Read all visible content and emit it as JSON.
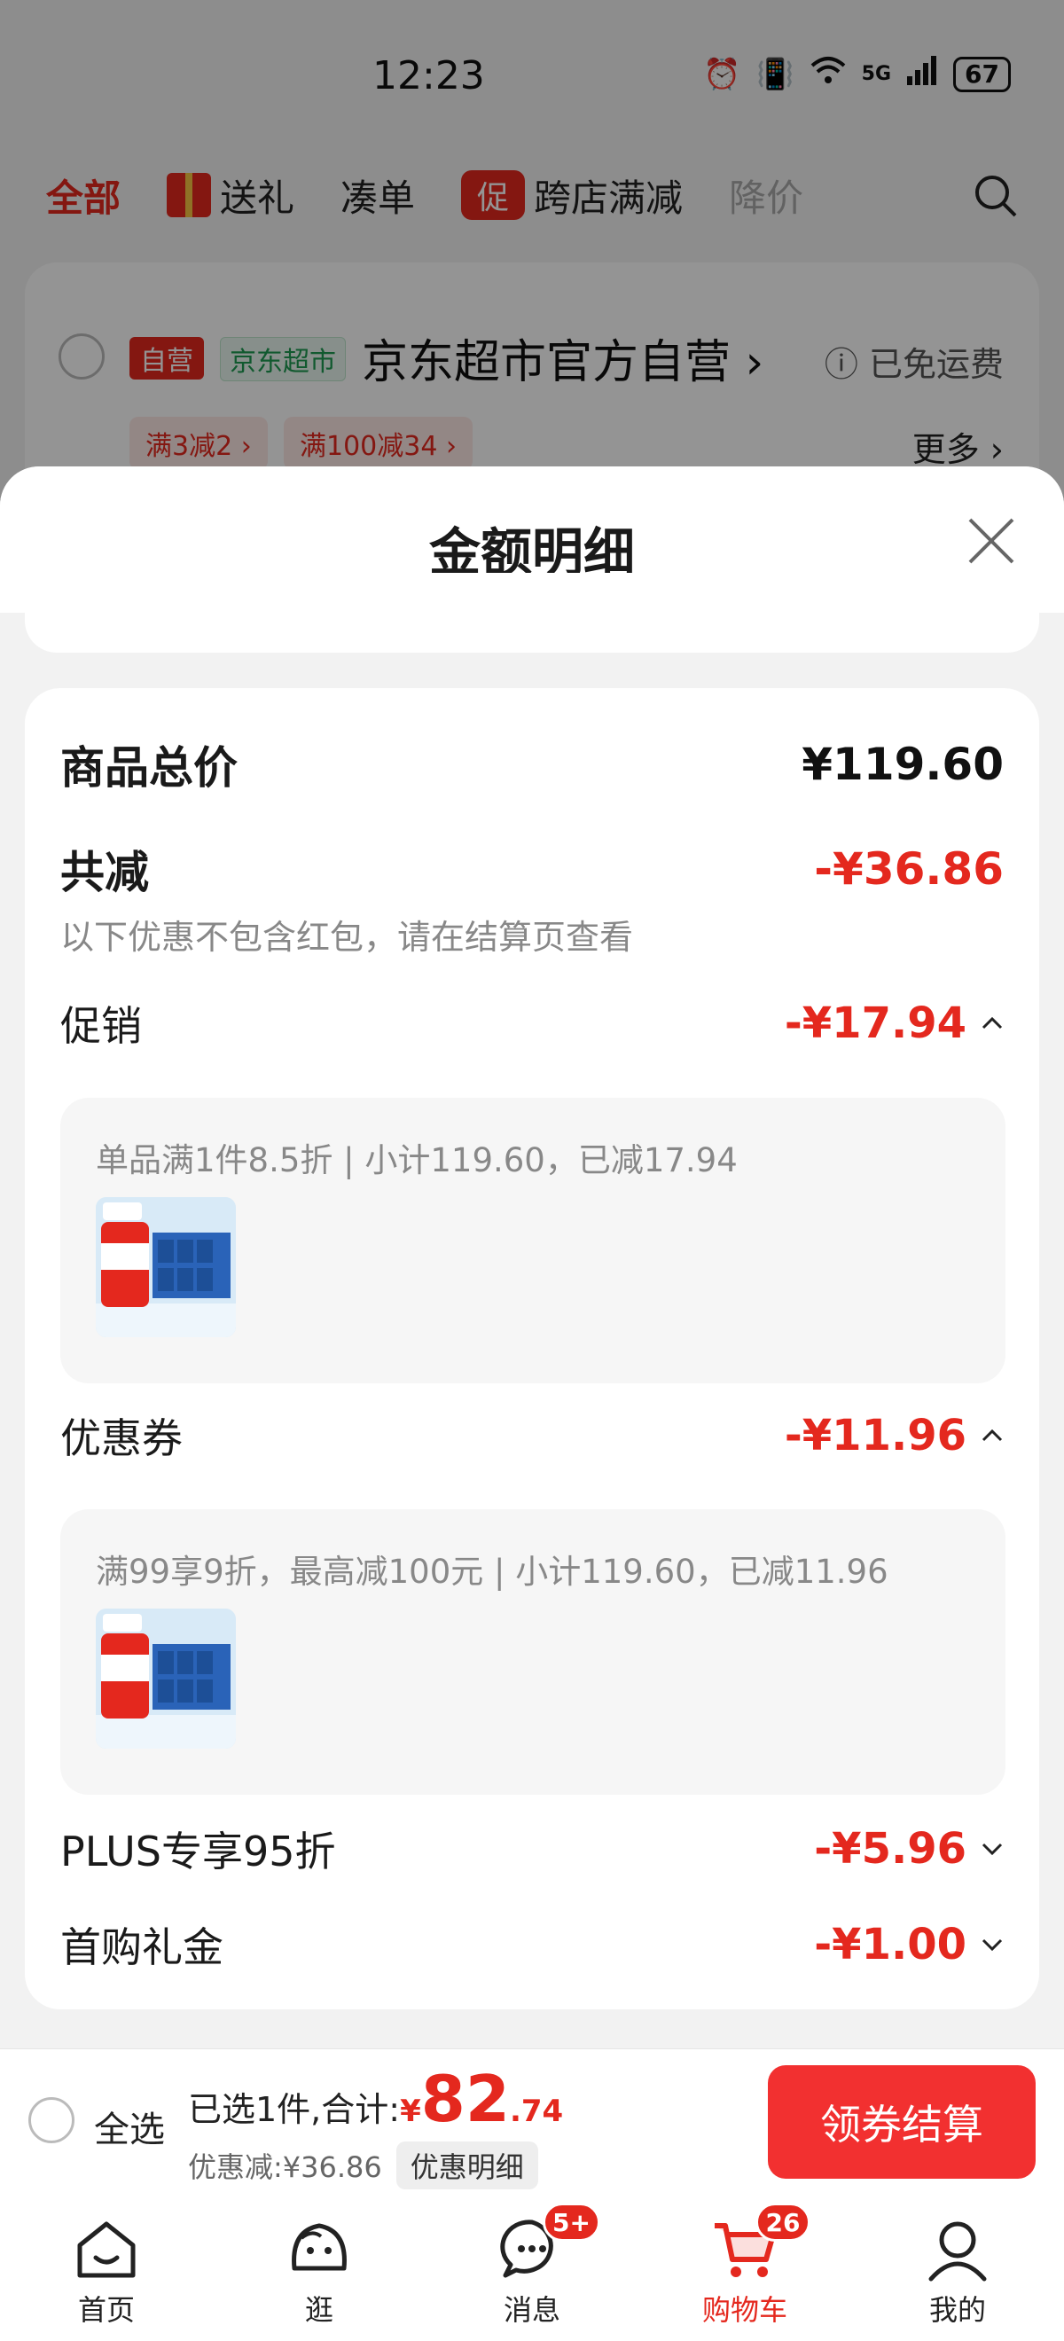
{
  "status_bar": {
    "time": "12:23",
    "network": "5G",
    "battery": "67"
  },
  "tabs": [
    {
      "label": "全部"
    },
    {
      "label": "送礼"
    },
    {
      "label": "凑单"
    },
    {
      "label": "跨店满减",
      "icon_text": "促"
    },
    {
      "label": "降价"
    }
  ],
  "store": {
    "tag_self": "自营",
    "tag_market": "京东超市",
    "name": "京东超市官方自营 ›",
    "free_shipping": "ⓘ 已免运费",
    "coupons": [
      "满3减2 ›",
      "满100减34 ›"
    ],
    "more": "更多 ›"
  },
  "sheet": {
    "title": "金额明细",
    "total_label": "商品总价",
    "total_value": "¥119.60",
    "reduce_label": "共减",
    "reduce_value": "-¥36.86",
    "note": "以下优惠不包含红包，请在结算页查看",
    "promo": {
      "label": "促销",
      "value": "-¥17.94",
      "detail": "单品满1件8.5折 | 小计119.60，已减17.94"
    },
    "coupon": {
      "label": "优惠券",
      "value": "-¥11.96",
      "detail": "满99享9折，最高减100元 | 小计119.60，已减11.96"
    },
    "plus": {
      "label": "PLUS专享95折",
      "value": "-¥5.96"
    },
    "first": {
      "label": "首购礼金",
      "value": "-¥1.00"
    }
  },
  "checkout": {
    "select_all": "全选",
    "selected_prefix": "已选1件,合计:",
    "price_symbol": "¥",
    "price_int": "82",
    "price_dec": ".74",
    "discount": "优惠减:¥36.86",
    "detail_button": "优惠明细",
    "checkout_button": "领券结算"
  },
  "nav": [
    {
      "label": "首页"
    },
    {
      "label": "逛"
    },
    {
      "label": "消息",
      "badge": "5+"
    },
    {
      "label": "购物车",
      "badge": "26"
    },
    {
      "label": "我的"
    }
  ],
  "colors": {
    "accent": "#e4281e",
    "checkout": "#f23030",
    "market_green": "#1e9a52"
  }
}
